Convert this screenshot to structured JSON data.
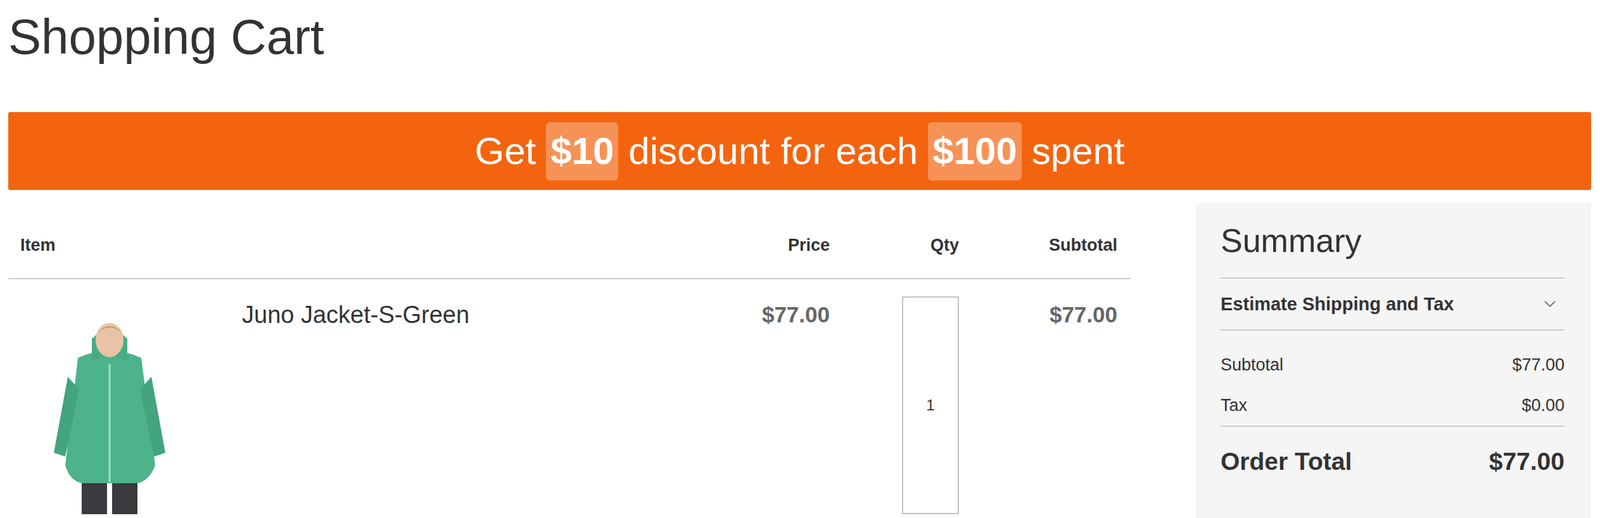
{
  "page": {
    "title": "Shopping Cart"
  },
  "banner": {
    "parts": [
      {
        "text": "Get",
        "highlight": false
      },
      {
        "text": "$10",
        "highlight": true
      },
      {
        "text": "discount for each",
        "highlight": false
      },
      {
        "text": "$100",
        "highlight": true
      },
      {
        "text": "spent",
        "highlight": false
      }
    ]
  },
  "cart": {
    "columns": [
      {
        "label": "Item",
        "align": "left"
      },
      {
        "label": "Price",
        "align": "right"
      },
      {
        "label": "Qty",
        "align": "right"
      },
      {
        "label": "Subtotal",
        "align": "right"
      }
    ],
    "rows": [
      {
        "name": "Juno Jacket-S-Green",
        "price": "$77.00",
        "qty": "1",
        "subtotal": "$77.00"
      }
    ]
  },
  "summary": {
    "title": "Summary",
    "shipping": {
      "label": "Estimate Shipping and Tax",
      "expanded": false
    },
    "lines": [
      {
        "label": "Subtotal",
        "value": "$77.00"
      },
      {
        "label": "Tax",
        "value": "$0.00"
      }
    ],
    "total": {
      "label": "Order Total",
      "value": "$77.00"
    }
  }
}
